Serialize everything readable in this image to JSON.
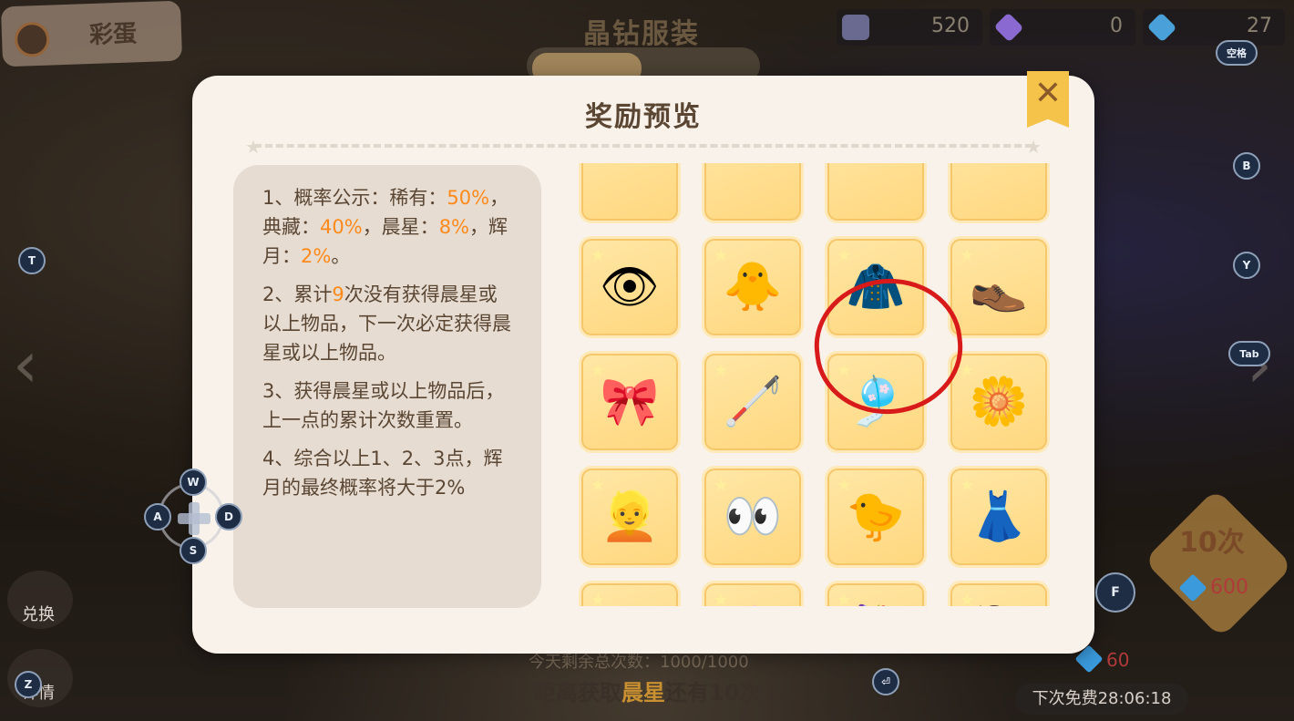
{
  "easter_egg": {
    "label": "彩蛋"
  },
  "scene_title": "晶钻服装",
  "currencies": [
    {
      "icon": "ticket-icon",
      "value": "520",
      "color": "#6a6a90"
    },
    {
      "icon": "purple-gem-icon",
      "value": "0",
      "color": "#8a6ad0"
    },
    {
      "icon": "diamond-plus-icon",
      "value": "27",
      "color": "#4aa0d8"
    }
  ],
  "keys": {
    "space": "空格",
    "b": "B",
    "y": "Y",
    "tab": "Tab",
    "t": "T",
    "w": "W",
    "a": "A",
    "s": "S",
    "d": "D",
    "f": "F",
    "z": "Z",
    "enter": "⏎"
  },
  "side_buttons": {
    "exchange": "兑换",
    "details": "详情"
  },
  "draw_ten": {
    "label": "10次",
    "cost": "600"
  },
  "draw_one": {
    "cost": "60"
  },
  "bottom": {
    "remaining": "今天剩余总次数：1000/1000",
    "countdown_pre": "距离获取",
    "countdown_key": "晨星",
    "countdown_post": "还有10次"
  },
  "free_timer": "下次免费28:06:18",
  "modal": {
    "title": "奖励预览",
    "close": "✕",
    "info": {
      "p1": {
        "a": "1、概率公示：稀有：",
        "rare": "50%",
        "b": "，典藏：",
        "coll": "40%",
        "c": "，晨星：",
        "morning": "8%",
        "d": "，辉月：",
        "moon": "2%",
        "e": "。"
      },
      "p2": {
        "a": "2、累计",
        "n": "9",
        "b": "次没有获得晨星或以上物品，下一次必定获得晨星或以上物品。"
      },
      "p3": "3、获得晨星或以上物品后，上一点的累计次数重置。",
      "p4": "4、综合以上1、2、3点，辉月的最终概率将大于2%"
    },
    "items": [
      {
        "name": "item-partial-1",
        "icon": ""
      },
      {
        "name": "item-partial-2",
        "icon": ""
      },
      {
        "name": "item-partial-3",
        "icon": ""
      },
      {
        "name": "item-partial-4",
        "icon": ""
      },
      {
        "name": "makeup-eyes-tears",
        "icon": "👁"
      },
      {
        "name": "yellow-puppy-hat",
        "icon": "🐥"
      },
      {
        "name": "dark-suit-outfit",
        "icon": "🧥"
      },
      {
        "name": "black-shoes",
        "icon": "👞"
      },
      {
        "name": "black-bow-hairpiece",
        "icon": "🎀"
      },
      {
        "name": "black-cane",
        "icon": "🦯"
      },
      {
        "name": "hanging-ornament-headdress",
        "icon": "🎐"
      },
      {
        "name": "white-floral-top",
        "icon": "🌼"
      },
      {
        "name": "blonde-hairstyle",
        "icon": "👱"
      },
      {
        "name": "green-eyes-makeup",
        "icon": "👀"
      },
      {
        "name": "yellow-puppy-hat-2",
        "icon": "🐤"
      },
      {
        "name": "green-floral-dress",
        "icon": "👗"
      },
      {
        "name": "green-shoes",
        "icon": "👟"
      },
      {
        "name": "flower-wand",
        "icon": "🌸"
      },
      {
        "name": "floral-outfit",
        "icon": "💐"
      },
      {
        "name": "short-blonde-hair",
        "icon": "💇"
      }
    ]
  }
}
